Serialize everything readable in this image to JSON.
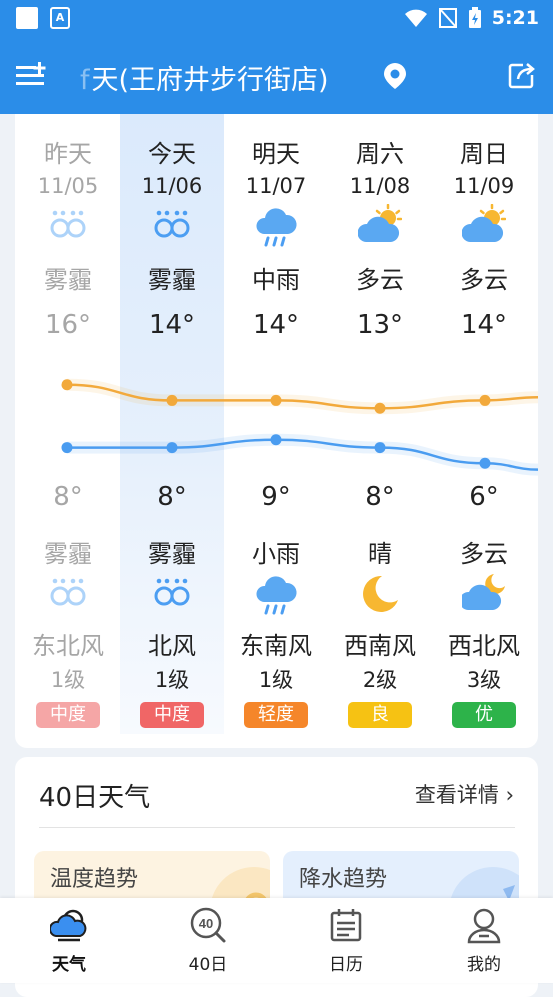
{
  "status_bar": {
    "time": "5:21"
  },
  "app_bar": {
    "title_faded": "f",
    "title": "天(王府井步行街店)"
  },
  "days": [
    {
      "name": "昨天",
      "date": "11/05",
      "day_weather": "雾霾",
      "day_icon": "haze-icon",
      "high": "16°",
      "low": "8°",
      "night_weather": "雾霾",
      "night_icon": "haze-icon",
      "wind_dir": "东北风",
      "wind_level": "1级",
      "aqi": "中度",
      "aqi_color": "#f5a6a6",
      "past": true
    },
    {
      "name": "今天",
      "date": "11/06",
      "day_weather": "雾霾",
      "day_icon": "haze-icon",
      "high": "14°",
      "low": "8°",
      "night_weather": "雾霾",
      "night_icon": "haze-icon",
      "wind_dir": "北风",
      "wind_level": "1级",
      "aqi": "中度",
      "aqi_color": "#f06666",
      "past": false
    },
    {
      "name": "明天",
      "date": "11/07",
      "day_weather": "中雨",
      "day_icon": "rain-cloud-icon",
      "high": "14°",
      "low": "9°",
      "night_weather": "小雨",
      "night_icon": "rain-cloud-icon",
      "wind_dir": "东南风",
      "wind_level": "1级",
      "aqi": "轻度",
      "aqi_color": "#f5862a",
      "past": false
    },
    {
      "name": "周六",
      "date": "11/08",
      "day_weather": "多云",
      "day_icon": "partly-cloudy-icon",
      "high": "13°",
      "low": "8°",
      "night_weather": "晴",
      "night_icon": "moon-icon",
      "wind_dir": "西南风",
      "wind_level": "2级",
      "aqi": "良",
      "aqi_color": "#f6c213",
      "past": false
    },
    {
      "name": "周日",
      "date": "11/09",
      "day_weather": "多云",
      "day_icon": "partly-cloudy-icon",
      "high": "14°",
      "low": "6°",
      "night_weather": "多云",
      "night_icon": "cloudy-night-icon",
      "wind_dir": "西北风",
      "wind_level": "3级",
      "aqi": "优",
      "aqi_color": "#2db34a",
      "past": false
    }
  ],
  "chart_data": {
    "type": "line",
    "categories": [
      "11/05",
      "11/06",
      "11/07",
      "11/08",
      "11/09"
    ],
    "series": [
      {
        "values": [
          16,
          14,
          14,
          13,
          14
        ],
        "color": "#f2a93b"
      },
      {
        "values": [
          8,
          8,
          9,
          8,
          6
        ],
        "color": "#4a9cf0"
      }
    ]
  },
  "forty_day": {
    "title": "40日天气",
    "more_label": "查看详情",
    "temp_trend_label": "温度趋势",
    "rain_trend_label": "降水趋势"
  },
  "bottom_nav": {
    "weather": "天气",
    "forty": "40日",
    "calendar": "日历",
    "mine": "我的",
    "forty_icon_text": "40"
  },
  "colors": {
    "primary": "#2b8de8",
    "high_line": "#f2a93b",
    "low_line": "#4a9cf0"
  }
}
